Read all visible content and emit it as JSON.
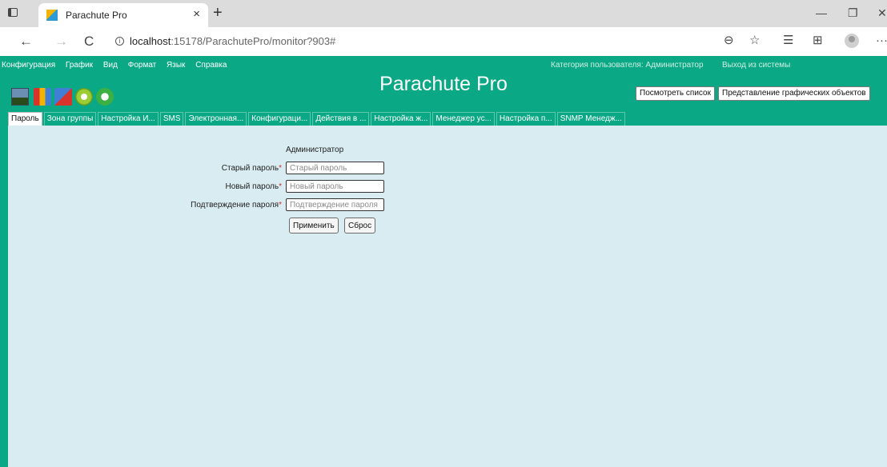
{
  "browser": {
    "tab_title": "Parachute Pro",
    "tab_close": "×",
    "new_tab": "+",
    "url_host": "localhost",
    "url_path": ":15178/ParachutePro/monitor?903#",
    "icons": [
      "tab-actions-icon",
      "favicon-icon",
      "close-icon",
      "plus-icon",
      "back-icon",
      "forward-icon",
      "refresh-icon",
      "info-icon",
      "zoom-icon",
      "favorite-add-icon",
      "favorites-icon",
      "collections-icon",
      "profile-icon",
      "more-icon",
      "minimize-icon",
      "restore-icon",
      "close-window-icon"
    ]
  },
  "window_controls": {
    "minimize": "—",
    "restore": "❐",
    "close": "✕"
  },
  "nav": {
    "back": "←",
    "forward": "→",
    "refresh": "C",
    "zoom": "⊖",
    "fav_add": "☆",
    "favorites": "☰",
    "collections": "⊞",
    "more": "···"
  },
  "menu": [
    "Конфигурация",
    "График",
    "Вид",
    "Формат",
    "Язык",
    "Справка"
  ],
  "header": {
    "user_category": "Категория пользователя:  Администратор",
    "logout": "Выход из системы",
    "title": "Parachute Pro",
    "view_list_button": "Посмотреть список",
    "graphic_view_button": "Представление графических объектов"
  },
  "toolbar_icons": [
    "monitor-icon",
    "report-icon",
    "settings-icon",
    "tools-icon",
    "refresh-icon"
  ],
  "tabs": [
    {
      "label": "Пароль",
      "active": true
    },
    {
      "label": "Зона группы",
      "active": false
    },
    {
      "label": "Настройка И...",
      "active": false
    },
    {
      "label": "SMS",
      "active": false
    },
    {
      "label": "Электронная...",
      "active": false
    },
    {
      "label": "Конфигураци...",
      "active": false
    },
    {
      "label": "Действия в ...",
      "active": false
    },
    {
      "label": "Настройка ж...",
      "active": false
    },
    {
      "label": "Менеджер ус...",
      "active": false
    },
    {
      "label": "Настройка п...",
      "active": false
    },
    {
      "label": "SNMP Менедж...",
      "active": false
    }
  ],
  "form": {
    "role": "Администратор",
    "required_mark": "*",
    "old_password": {
      "label": "Старый пароль",
      "placeholder": "Старый пароль",
      "value": ""
    },
    "new_password": {
      "label": "Новый пароль",
      "placeholder": "Новый пароль",
      "value": ""
    },
    "confirm_password": {
      "label": "Подтверждение пароля",
      "placeholder": "Подтверждение пароля",
      "value": ""
    },
    "apply_button": "Применить",
    "reset_button": "Сброс"
  },
  "colors": {
    "app_bg": "#0aa884",
    "panel_bg": "#d8ecf1",
    "required": "#d43030"
  }
}
